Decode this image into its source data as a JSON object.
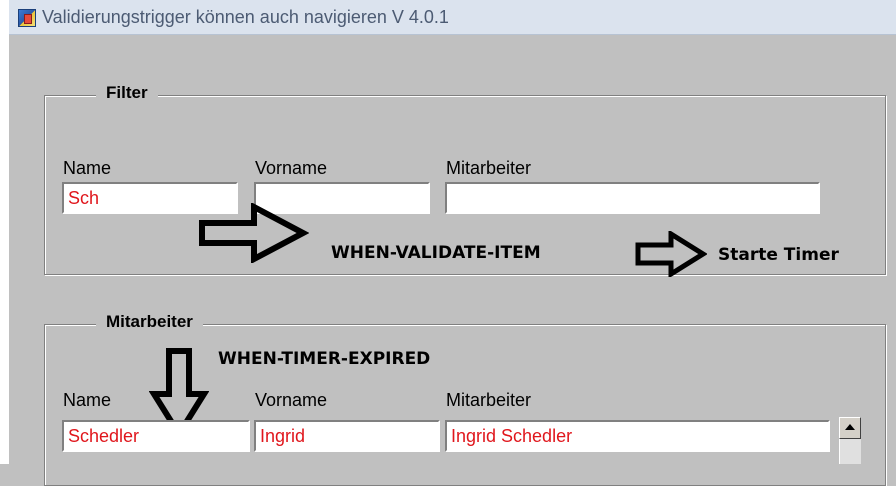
{
  "window": {
    "title": "Validierungstrigger können auch navigieren V 4.0.1"
  },
  "filter": {
    "legend": "Filter",
    "labels": {
      "name": "Name",
      "vorname": "Vorname",
      "mitarbeiter": "Mitarbeiter"
    },
    "values": {
      "name": "Sch",
      "vorname": "",
      "mitarbeiter": ""
    }
  },
  "annotations": {
    "validate": "WHEN-VALIDATE-ITEM",
    "timer_start": "Starte Timer",
    "timer_expired": "WHEN-TIMER-EXPIRED"
  },
  "results": {
    "legend": "Mitarbeiter",
    "labels": {
      "name": "Name",
      "vorname": "Vorname",
      "mitarbeiter": "Mitarbeiter"
    },
    "row": {
      "name": "Schedler",
      "vorname": "Ingrid",
      "mitarbeiter": "Ingrid Schedler"
    }
  },
  "colors": {
    "field_text": "#e0161c",
    "canvas": "#c0c0c0",
    "titlebar": "#dbe3ee"
  },
  "icons": [
    "app-icon",
    "right-arrow-icon",
    "down-arrow-icon",
    "scroll-up-icon"
  ]
}
